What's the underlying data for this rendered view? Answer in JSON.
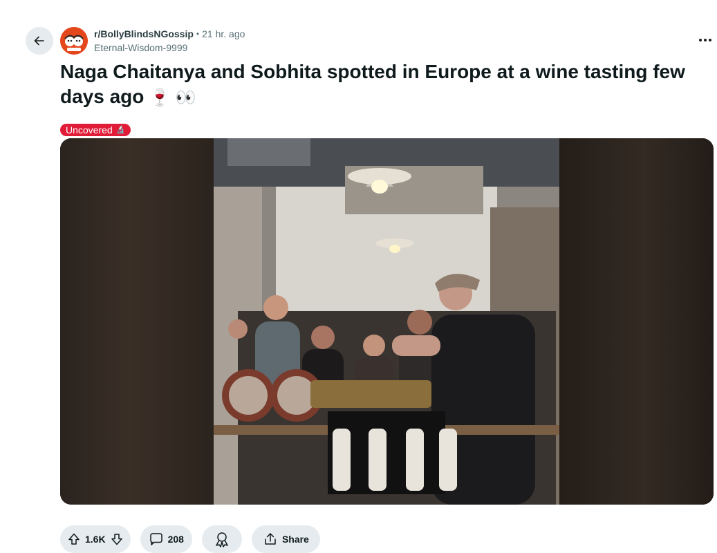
{
  "nav": {
    "back_icon": "arrow-left-icon"
  },
  "post": {
    "subreddit": "r/BollyBlindsNGossip",
    "separator": "•",
    "time_ago": "21 hr. ago",
    "author": "Eternal-Wisdom-9999",
    "title": "Naga Chaitanya and Sobhita spotted in Europe at a wine tasting few days ago",
    "title_emojis": "🍷 👀",
    "flair": {
      "label": "Uncovered",
      "icon": "🔬",
      "color": "#e01c39"
    },
    "media": {
      "type": "video-thumbnail"
    }
  },
  "actions": {
    "upvotes": "1.6K",
    "comments": "208",
    "share_label": "Share",
    "icons": [
      "upvote-icon",
      "downvote-icon",
      "comment-icon",
      "award-icon",
      "share-icon"
    ]
  },
  "colors": {
    "button_bg": "#e5ebee",
    "flair": "#e01c39",
    "avatar": "#e5471d"
  }
}
